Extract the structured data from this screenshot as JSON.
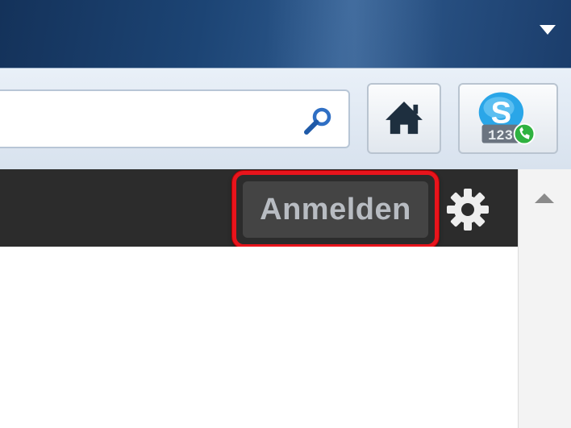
{
  "toolbar": {
    "login_label": "Anmelden"
  },
  "skype": {
    "badge_text": "123"
  },
  "icons": {
    "menu": "chevron-down-icon",
    "search": "search-icon",
    "home": "home-icon",
    "skype": "skype-icon",
    "settings": "gear-icon",
    "scroll_up": "scroll-up-icon"
  },
  "colors": {
    "highlight": "#e8141c",
    "toolbar_bg": "#2c2c2c",
    "login_text": "#b8bcc2"
  }
}
